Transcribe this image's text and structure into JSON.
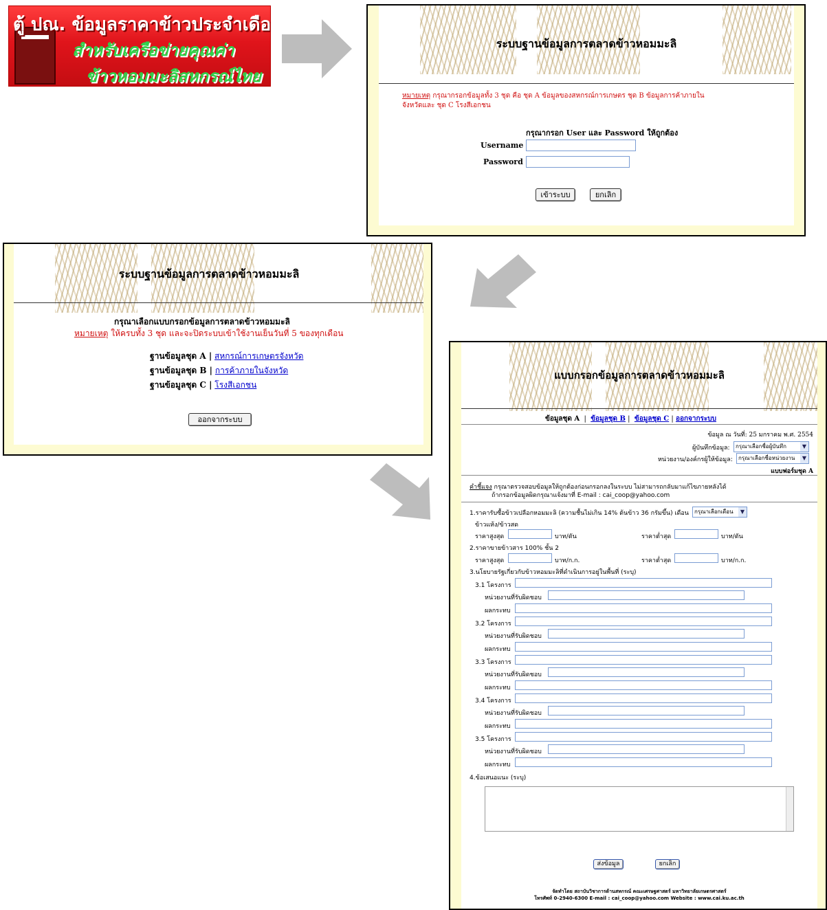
{
  "banner": {
    "line1": "ตู้ ปณ. ข้อมูลราคาข้าวประจำเดือน",
    "line2": "สำหรับเครือข่ายคุณค่า",
    "line3": "ข้าวหอมมะลิสหกรณ์ไทย"
  },
  "login": {
    "title": "ระบบฐานข้อมูลการตลาดข้าวหอมมะลิ",
    "note_label": "หมายเหตุ",
    "note_text": "กรุณากรอกข้อมูลทั้ง 3 ชุด คือ ชุด A ข้อมูลของสหกรณ์การเกษตร ชุด B ข้อมูลการค้าภายใน",
    "note_text2": "จังหวัดและ ชุด C โรงสีเอกชน",
    "prompt": "กรุณากรอก User และ Password ให้ถูกต้อง",
    "username_label": "Username :",
    "password_label": "Password :",
    "login_button": "เข้าระบบ",
    "cancel_button": "ยกเลิก"
  },
  "menu": {
    "title": "ระบบฐานข้อมูลการตลาดข้าวหอมมะลิ",
    "prompt": "กรุณาเลือกแบบกรอกข้อมูลการตลาดข้าวหอมมะลิ",
    "note_label": "หมายเหตุ",
    "note_text": "ให้ครบทั้ง 3 ชุด และจะปิดระบบเข้าใช้งานเย็นวันที่ 5 ของทุกเดือน",
    "sets": [
      {
        "label": "ฐานข้อมูลชุด A |",
        "link": "สหกรณ์การเกษตรจังหวัด"
      },
      {
        "label": "ฐานข้อมูลชุด B |",
        "link": "การค้าภายในจังหวัด"
      },
      {
        "label": "ฐานข้อมูลชุด C |",
        "link": "โรงสีเอกชน"
      }
    ],
    "logout_button": "ออกจากระบบ"
  },
  "form": {
    "title": "แบบกรอกข้อมูลการตลาดข้าวหอมมะลิ",
    "nav_current": "ข้อมูลชุด A",
    "nav_sep": "|",
    "nav_b": "ข้อมูลชุด B",
    "nav_c": "ข้อมูลชุด C",
    "nav_logout": "ออกจากระบบ",
    "date_line": "ข้อมูล ณ วันที่: 25 มกราคม พ.ศ. 2554",
    "recorder_label": "ผู้บันทึกข้อมูล:",
    "recorder_value": "กรุณาเลือกชื่อผู้บันทึก",
    "agency_label": "หน่วยงาน/องค์กรผู้ให้ข้อมูล:",
    "agency_value": "กรุณาเลือกชื่อหน่วยงาน",
    "form_name": "แบบฟอร์มชุด A",
    "instr_label": "คำชี้แจง",
    "instr_text": "กรุณาตรวจสอบข้อมูลให้ถูกต้องก่อนกรอกลงในระบบ ไม่สามารถกลับมาแก้ไขภายหลังได้",
    "instr_text2": "ถ้ากรอกข้อมูลผิดกรุณาแจ้งมาที่ E-mail : cai_coop@yahoo.com",
    "q1": "1.ราคารับซื้อข้าวเปลือกหอมมะลิ (ความชื้นไม่เกิน 14% ต้นข้าว 36 กรัมขึ้น) เดือน",
    "q1_month": "กรุณาเลือกเดือน",
    "q1_sub": "ข้าวแห้ง/ข้าวสด",
    "max_price": "ราคาสูงสุด",
    "min_price": "ราคาต่ำสุด",
    "unit_ton": "บาท/ตัน",
    "q2": "2.ราคาขายข้าวสาร 100% ชั้น 2",
    "unit_kg": "บาท/ก.ก.",
    "q3": "3.นโยบายรัฐเกี่ยวกับข้าวหอมมะลิที่ดำเนินการอยู่ในพื้นที่ (ระบุ)",
    "projects": [
      "3.1 โครงการ",
      "3.2 โครงการ",
      "3.3 โครงการ",
      "3.4 โครงการ",
      "3.5 โครงการ"
    ],
    "resp_label": "หน่วยงานที่รับผิดชอบ",
    "impact_label": "ผลกระทบ",
    "q4": "4.ข้อเสนอแนะ (ระบุ)",
    "submit_button": "ส่งข้อมูล",
    "cancel_button": "ยกเลิก",
    "footer1": "จัดทำโดย สถาบันวิชาการด้านสหกรณ์ คณะเศรษฐศาสตร์ มหาวิทยาลัยเกษตรศาสตร์",
    "footer2": "โทรศัพท์ 0-2940-6300 E-mail : cai_coop@yahoo.com Website : www.cai.ku.ac.th"
  },
  "colors": {
    "note_red": "#d01010",
    "link_blue": "#0000cc",
    "panel_bg": "#fdfbd2",
    "arrow_gray": "#bdbdbd"
  }
}
